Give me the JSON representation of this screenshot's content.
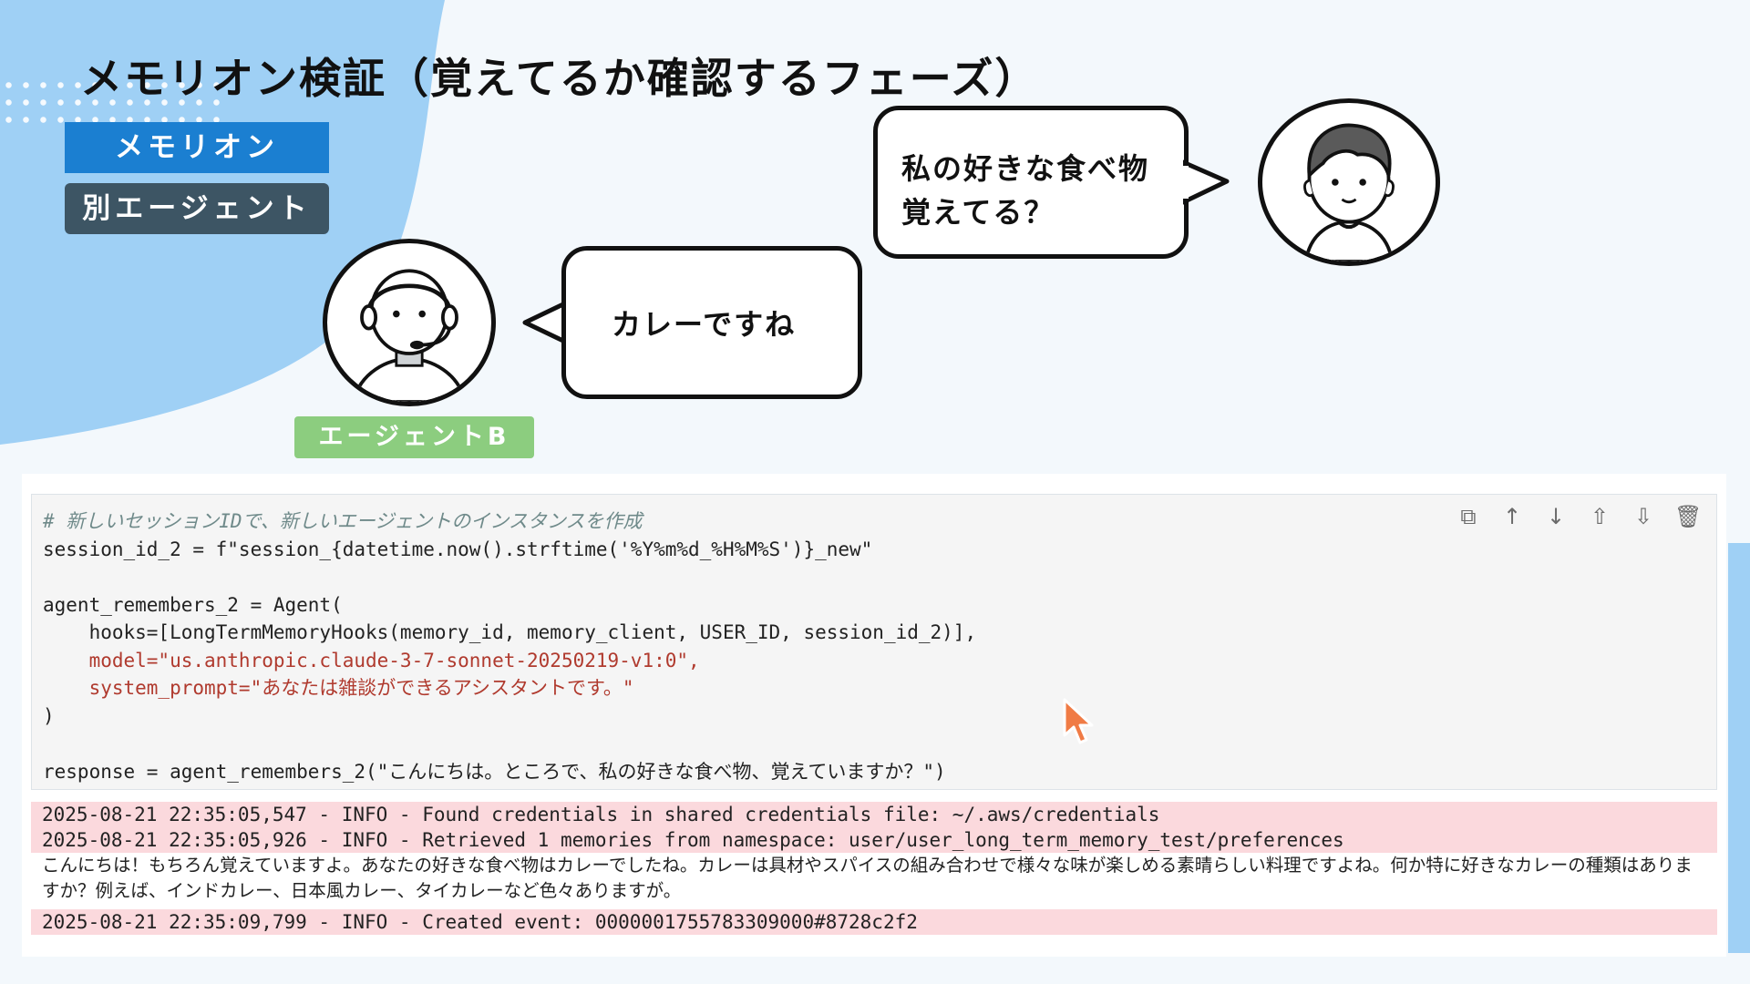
{
  "slide": {
    "title": "メモリオン検証（覚えてるか確認するフェーズ）",
    "tags": {
      "memorion": "メモリオン",
      "other_agent": "別エージェント",
      "agent_b": "エージェントB"
    },
    "bubbles": {
      "user": [
        "私の好きな食べ物",
        "覚えてる？"
      ],
      "agent": "カレーですね"
    },
    "colors": {
      "blob": "#9fd0f5",
      "memorion_tag": "#1b7fd1",
      "other_agent_tag": "#3d5564",
      "agent_b_tag": "#8ccd7f",
      "log_highlight": "#fbd9dd"
    }
  },
  "notebook": {
    "toolbar": [
      {
        "icon": "copy-icon",
        "glyph": "⧉"
      },
      {
        "icon": "arrow-up-icon",
        "glyph": "↑"
      },
      {
        "icon": "arrow-down-icon",
        "glyph": "↓"
      },
      {
        "icon": "insert-above-icon",
        "glyph": "⇧"
      },
      {
        "icon": "insert-below-icon",
        "glyph": "⇩"
      },
      {
        "icon": "trash-icon",
        "glyph": "🗑"
      }
    ],
    "code": {
      "comment": "# 新しいセッションIDで、新しいエージェントのインスタンスを作成",
      "line_session": "session_id_2 = f\"session_{datetime.now().strftime('%Y%m%d_%H%M%S')}_new\"",
      "line_agent": "agent_remembers_2 = Agent(",
      "line_hooks": "    hooks=[LongTermMemoryHooks(memory_id, memory_client, USER_ID, session_id_2)],",
      "line_model": "    model=\"us.anthropic.claude-3-7-sonnet-20250219-v1:0\",",
      "line_prompt": "    system_prompt=\"あなたは雑談ができるアシスタントです。\"",
      "line_close": ")",
      "line_response": "response = agent_remembers_2(\"こんにちは。ところで、私の好きな食べ物、覚えていますか？\")"
    },
    "output": {
      "log1": "2025-08-21 22:35:05,547 - INFO - Found credentials in shared credentials file: ~/.aws/credentials",
      "log2": "2025-08-21 22:35:05,926 - INFO - Retrieved 1 memories from namespace: user/user_long_term_memory_test/preferences",
      "reply": "こんにちは！もちろん覚えていますよ。あなたの好きな食べ物はカレーでしたね。カレーは具材やスパイスの組み合わせで様々な味が楽しめる素晴らしい料理ですよね。何か特に好きなカレーの種類はありますか？例えば、インドカレー、日本風カレー、タイカレーなど色々ありますが。",
      "log3": "2025-08-21 22:35:09,799 - INFO - Created event: 0000001755783309000#8728c2f2"
    }
  }
}
